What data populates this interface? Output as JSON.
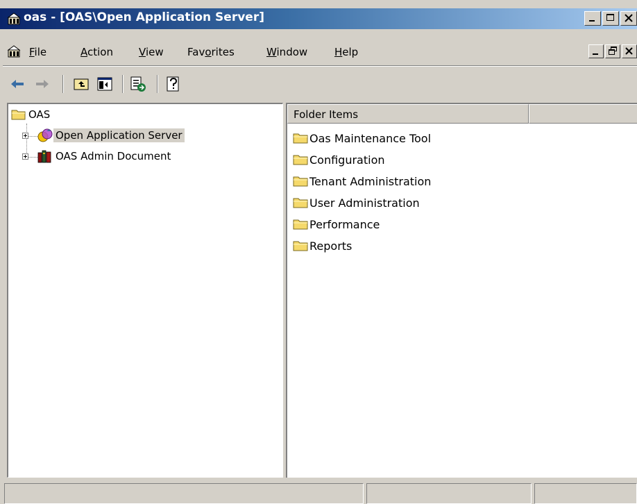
{
  "window": {
    "title": "oas - [OAS\\Open Application Server]",
    "controls": [
      "minimize-icon",
      "maximize-icon",
      "close-icon"
    ],
    "title_gradient": [
      "#0a246a",
      "#a6caf0"
    ]
  },
  "menubar": {
    "items": [
      {
        "accel": "F",
        "rest": "ile"
      },
      {
        "accel": "A",
        "rest": "ction"
      },
      {
        "accel": "V",
        "rest": "iew"
      },
      {
        "pre": "Fav",
        "accel": "o",
        "rest": "rites"
      },
      {
        "accel": "W",
        "rest": "indow"
      },
      {
        "accel": "H",
        "rest": "elp"
      }
    ],
    "mdi_controls": [
      "minimize-icon",
      "restore-icon",
      "close-icon"
    ]
  },
  "toolbar": {
    "buttons": [
      "back-arrow-icon",
      "forward-arrow-icon",
      "up-one-level-icon",
      "show-hide-tree-icon",
      "export-list-icon",
      "help-icon"
    ]
  },
  "tree": {
    "root": {
      "label": "OAS",
      "icon": "folder-icon"
    },
    "children": [
      {
        "label": "Open Application Server",
        "icon": "server-icon",
        "selected": true
      },
      {
        "label": "OAS Admin Document",
        "icon": "books-icon",
        "selected": false
      }
    ]
  },
  "list": {
    "columns": [
      "Folder Items",
      ""
    ],
    "items": [
      "Oas Maintenance Tool",
      "Configuration",
      "Tenant Administration",
      "User Administration",
      "Performance",
      "Reports"
    ]
  },
  "statusbar": {
    "panels": [
      "",
      "",
      ""
    ]
  },
  "colors": {
    "face": "#d4d0c8",
    "folder": "#f5d96b",
    "title_bar": "#0a246a"
  }
}
